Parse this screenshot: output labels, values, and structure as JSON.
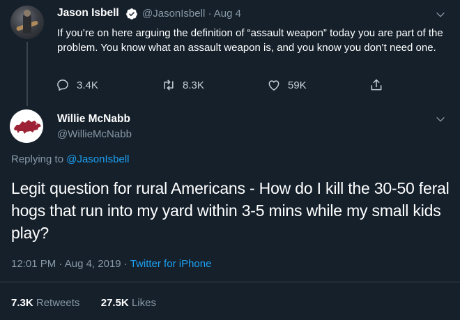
{
  "tweet1": {
    "author_name": "Jason Isbell",
    "handle": "@JasonIsbell",
    "separator": "·",
    "date": "Aug 4",
    "text": "If you’re on here arguing the definition of “assault weapon” today you are part of the problem. You know what an assault weapon is, and you know you don’t need one.",
    "replies": "3.4K",
    "retweets": "8.3K",
    "likes": "59K",
    "icons": {
      "avatar": "guitarist-photo",
      "verified": "verified-badge-icon",
      "menu": "chevron-down-icon",
      "reply": "reply-icon",
      "retweet": "retweet-icon",
      "like": "heart-icon",
      "share": "share-icon"
    }
  },
  "tweet2": {
    "author_name": "Willie McNabb",
    "handle": "@WillieMcNabb",
    "replying_prefix": "Replying to",
    "replying_to": "@JasonIsbell",
    "text": "Legit question for rural Americans - How do I kill the 30-50 feral hogs that run into my yard within 3-5 mins while my small kids play?",
    "time": "12:01 PM",
    "sep1": "·",
    "date": "Aug 4, 2019",
    "sep2": "·",
    "source": "Twitter for iPhone",
    "retweets_count": "7.3K",
    "retweets_label": "Retweets",
    "likes_count": "27.5K",
    "likes_label": "Likes",
    "icons": {
      "avatar": "razorback-hog-logo",
      "menu": "chevron-down-icon"
    }
  },
  "colors": {
    "background": "#15202b",
    "text": "#ffffff",
    "secondary_text": "#8899a6",
    "link": "#1da1f2",
    "divider": "#38444d",
    "razorback_red": "#9d2235"
  }
}
